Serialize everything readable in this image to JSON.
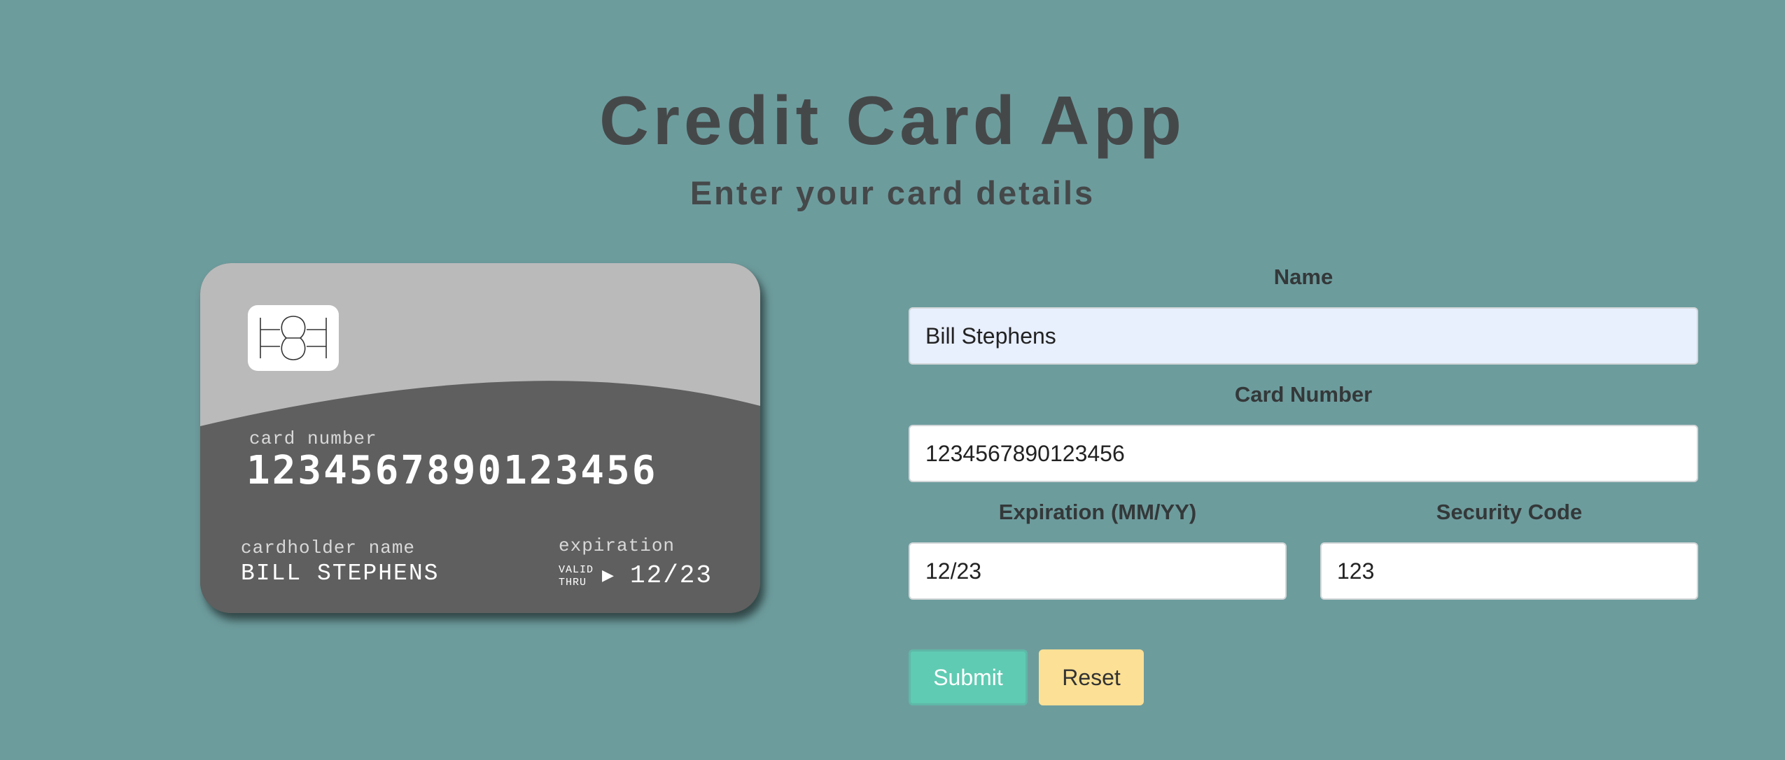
{
  "header": {
    "title": "Credit Card App",
    "subtitle": "Enter your card details"
  },
  "card": {
    "number_label": "card number",
    "number_value": "1234567890123456",
    "holder_label": "cardholder name",
    "holder_value": "BILL STEPHENS",
    "expiration_label": "expiration",
    "valid_thru_line1": "VALID",
    "valid_thru_line2": "THRU",
    "arrow_icon": "▶",
    "expiration_value": "12/23",
    "chip_icon": "chip-icon",
    "colors": {
      "top": "#bababa",
      "bottom": "#5f5f5f"
    }
  },
  "form": {
    "name_label": "Name",
    "name_value": "Bill Stephens",
    "card_number_label": "Card Number",
    "card_number_value": "1234567890123456",
    "expiration_label": "Expiration (MM/YY)",
    "expiration_value": "12/23",
    "security_label": "Security Code",
    "security_value": "123",
    "submit_label": "Submit",
    "reset_label": "Reset"
  },
  "colors": {
    "background": "#6d9c9d",
    "submit": "#5fcbb2",
    "reset": "#fbe095",
    "text_dark": "#454849"
  }
}
